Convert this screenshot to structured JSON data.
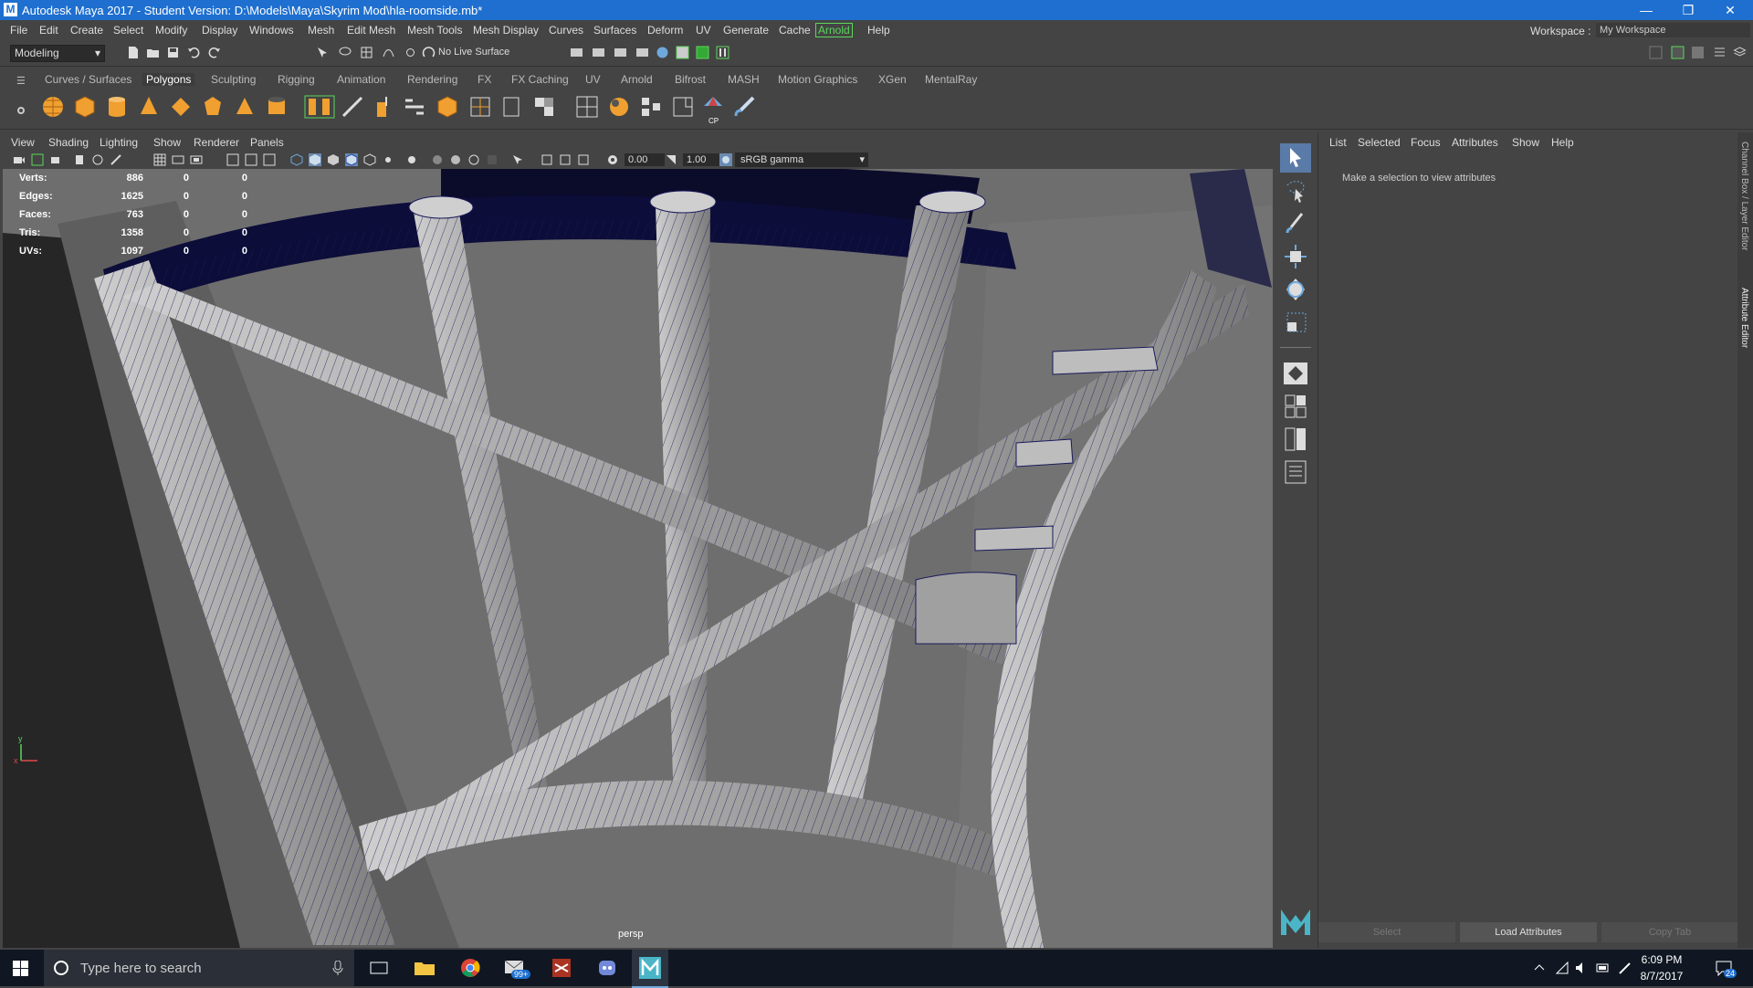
{
  "window": {
    "title": "Autodesk Maya 2017 - Student Version: D:\\Models\\Maya\\Skyrim Mod\\hla-roomside.mb*",
    "app_icon": "M",
    "minimize_icon": "minimize-icon",
    "restore_icon": "restore-icon",
    "close_icon": "close-icon"
  },
  "menubar": {
    "items": [
      "File",
      "Edit",
      "Create",
      "Select",
      "Modify",
      "Display",
      "Windows",
      "Mesh",
      "Edit Mesh",
      "Mesh Tools",
      "Mesh Display",
      "Curves",
      "Surfaces",
      "Deform",
      "UV",
      "Generate",
      "Cache",
      "Arnold",
      "Help"
    ],
    "workspace_label": "Workspace :",
    "workspace_value": "My Workspace"
  },
  "statusline": {
    "mode": "Modeling",
    "live_surface": "No Live Surface"
  },
  "shelf": {
    "tabs": [
      "Curves / Surfaces",
      "Polygons",
      "Sculpting",
      "Rigging",
      "Animation",
      "Rendering",
      "FX",
      "FX Caching",
      "UV",
      "Arnold",
      "Bifrost",
      "MASH",
      "Motion Graphics",
      "XGen",
      "MentalRay"
    ],
    "active_tab": "Polygons",
    "icons": [
      "poly-sphere-icon",
      "poly-cube-icon",
      "poly-cylinder-icon",
      "poly-cone-icon",
      "poly-plane-icon",
      "poly-torus-icon",
      "poly-prism-icon",
      "poly-pipe-icon",
      "combine-icon",
      "separate-icon",
      "extrude-icon",
      "bridge-icon",
      "bevel-icon",
      "merge-icon",
      "multicut-icon",
      "target-weld-icon",
      "uv-editor-icon",
      "sculpt-icon",
      "cut-uv-icon",
      "cp-icon",
      "paint-icon"
    ],
    "cp_label": "CP"
  },
  "panel": {
    "menus": [
      "View",
      "Shading",
      "Lighting",
      "Show",
      "Renderer",
      "Panels"
    ],
    "exposure": "0.00",
    "gamma": "1.00",
    "color_space": "sRGB gamma",
    "camera": "persp"
  },
  "hud": {
    "rows": [
      {
        "label": "Verts:",
        "v1": "886",
        "v2": "0",
        "v3": "0"
      },
      {
        "label": "Edges:",
        "v1": "1625",
        "v2": "0",
        "v3": "0"
      },
      {
        "label": "Faces:",
        "v1": "763",
        "v2": "0",
        "v3": "0"
      },
      {
        "label": "Tris:",
        "v1": "1358",
        "v2": "0",
        "v3": "0"
      },
      {
        "label": "UVs:",
        "v1": "1097",
        "v2": "0",
        "v3": "0"
      }
    ],
    "axis_y": "y",
    "axis_x": "x"
  },
  "attribute_editor": {
    "menus": [
      "List",
      "Selected",
      "Focus",
      "Attributes",
      "Show",
      "Help"
    ],
    "message": "Make a selection to view attributes",
    "buttons": [
      "Select",
      "Load Attributes",
      "Copy Tab"
    ],
    "side_tabs": [
      "Channel Box / Layer Editor",
      "Attribute Editor"
    ]
  },
  "taskbar": {
    "search_placeholder": "Type here to search",
    "time": "6:09 PM",
    "date": "8/7/2017",
    "mail_badge": "99+",
    "notification_count": "24"
  }
}
